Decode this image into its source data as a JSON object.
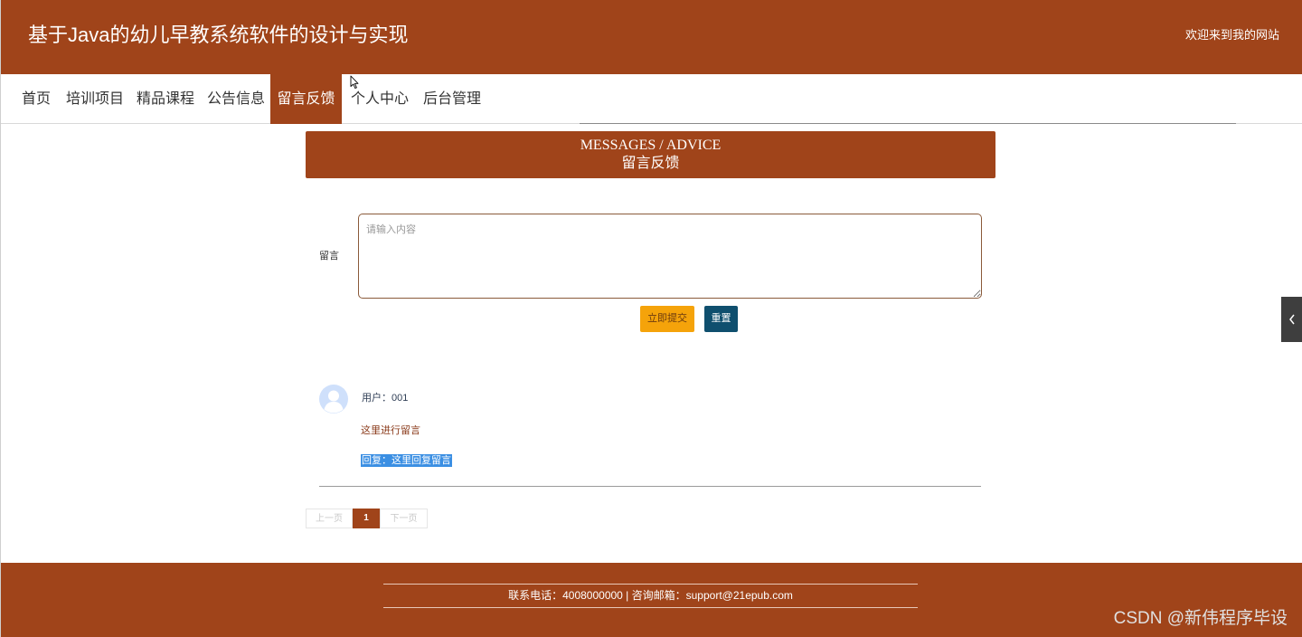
{
  "header": {
    "site_title": "基于Java的幼儿早教系统软件的设计与实现",
    "welcome_text": "欢迎来到我的网站"
  },
  "nav": {
    "items": [
      {
        "label": "首页"
      },
      {
        "label": "培训项目"
      },
      {
        "label": "精品课程"
      },
      {
        "label": "公告信息"
      },
      {
        "label": "留言反馈",
        "active": true
      },
      {
        "label": "个人中心"
      },
      {
        "label": "后台管理"
      }
    ]
  },
  "banner": {
    "title_en": "MESSAGES / ADVICE",
    "title_cn": "留言反馈"
  },
  "form": {
    "message_label": "留言",
    "message_placeholder": "请输入内容",
    "message_value": "",
    "submit_label": "立即提交",
    "reset_label": "重置"
  },
  "comments": [
    {
      "user": "用户：001",
      "content": "这里进行留言",
      "reply": "回复：这里回复留言"
    }
  ],
  "pagination": {
    "prev_label": "上一页",
    "current_page": "1",
    "next_label": "下一页"
  },
  "footer": {
    "contact": "联系电话：4008000000 | 咨询邮箱：support@21epub.com"
  },
  "watermark": "CSDN @新伟程序毕设",
  "colors": {
    "brand": "#a0441a",
    "submit_button": "#f5a30a",
    "reset_button": "#0f4f6e",
    "reply_highlight": "#3b8fe3"
  },
  "icons": {
    "avatar": "user-avatar-icon",
    "side_toggle": "chevron-left-icon",
    "cursor": "mouse-pointer-icon"
  }
}
